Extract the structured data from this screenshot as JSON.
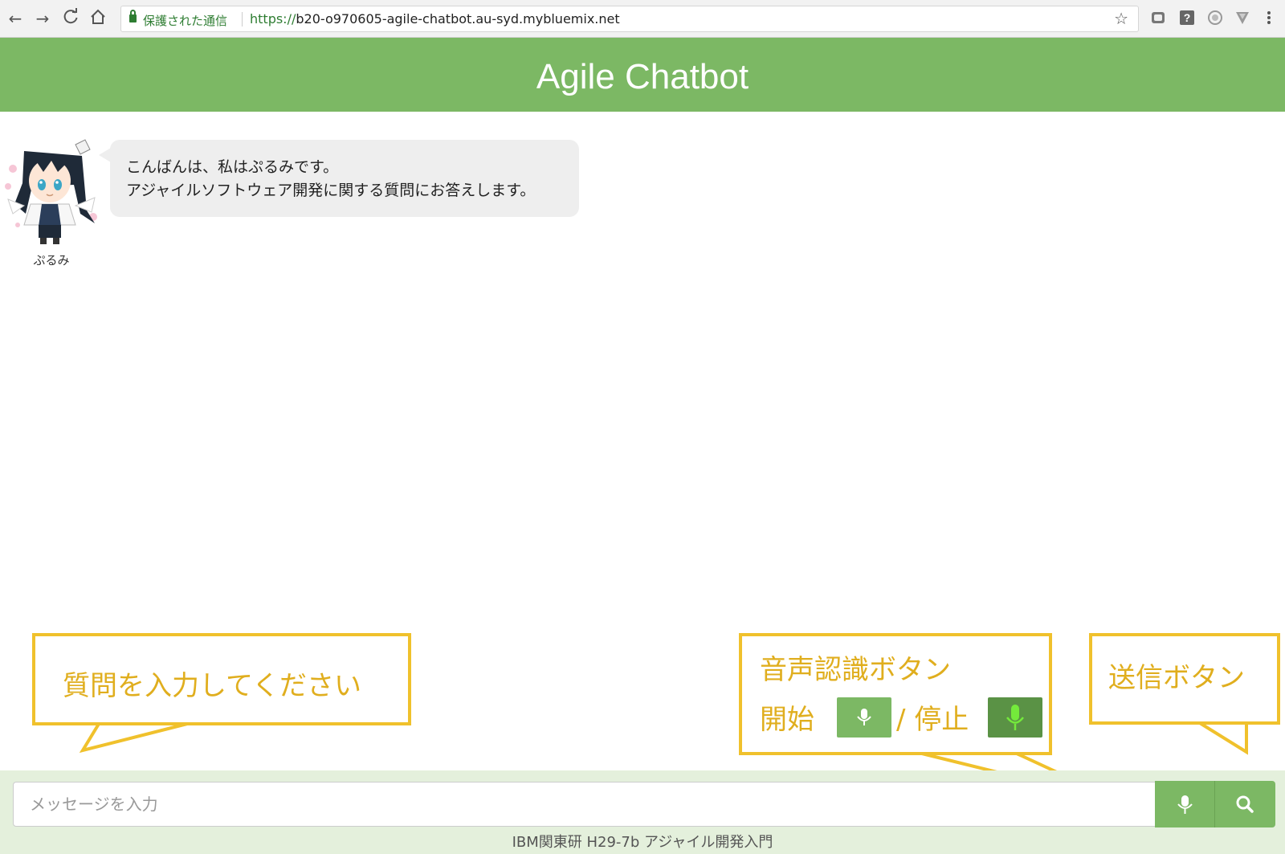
{
  "browser": {
    "secure_label": "保護された通信",
    "url_scheme": "https://",
    "url_rest": "b20-o970605-agile-chatbot.au-syd.mybluemix.net",
    "icons": [
      "back-icon",
      "forward-icon",
      "reload-icon",
      "home-icon",
      "star-icon",
      "extension-icon",
      "help-icon",
      "profile-icon",
      "vivaldi-icon",
      "menu-icon"
    ]
  },
  "header": {
    "title": "Agile Chatbot"
  },
  "chat": {
    "bot_name": "ぷるみ",
    "messages": [
      {
        "line1": "こんばんは、私はぷるみです。",
        "line2": "アジャイルソフトウェア開発に関する質問にお答えします。"
      }
    ]
  },
  "callouts": {
    "input_hint": "質問を入力してください",
    "voice_title": "音声認識ボタン",
    "voice_start": "開始",
    "voice_stop": "/ 停止",
    "send": "送信ボタン"
  },
  "composer": {
    "placeholder": "メッセージを入力"
  },
  "footer": {
    "text": "IBM関東研 H29-7b アジャイル開発入門"
  },
  "colors": {
    "brand": "#7cb864",
    "callout": "#f0c12c",
    "mic_active": "#74ea3b"
  }
}
